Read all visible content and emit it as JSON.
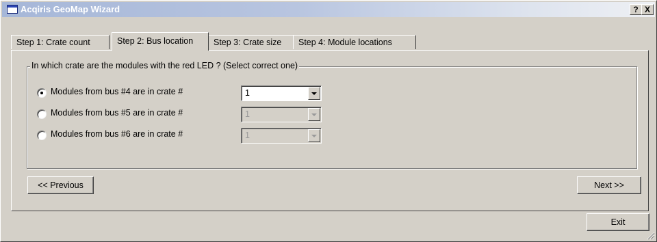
{
  "window": {
    "title": "Acqiris GeoMap Wizard",
    "help_label": "?",
    "close_label": "X"
  },
  "tabs": [
    {
      "label": "Step 1: Crate count",
      "active": false
    },
    {
      "label": "Step 2: Bus location",
      "active": true
    },
    {
      "label": "Step 3: Crate size",
      "active": false
    },
    {
      "label": "Step 4: Module locations",
      "active": false
    }
  ],
  "group": {
    "legend": "In which crate are the modules with the red LED ? (Select correct one)",
    "options": [
      {
        "label": "Modules from bus #4 are in crate #",
        "selected": true,
        "value": "1",
        "enabled": true
      },
      {
        "label": "Modules from bus #5 are in crate #",
        "selected": false,
        "value": "1",
        "enabled": false
      },
      {
        "label": "Modules from bus #6 are in crate #",
        "selected": false,
        "value": "1",
        "enabled": false
      }
    ]
  },
  "nav": {
    "previous_label": "<< Previous",
    "next_label": "Next >>"
  },
  "footer": {
    "exit_label": "Exit"
  }
}
